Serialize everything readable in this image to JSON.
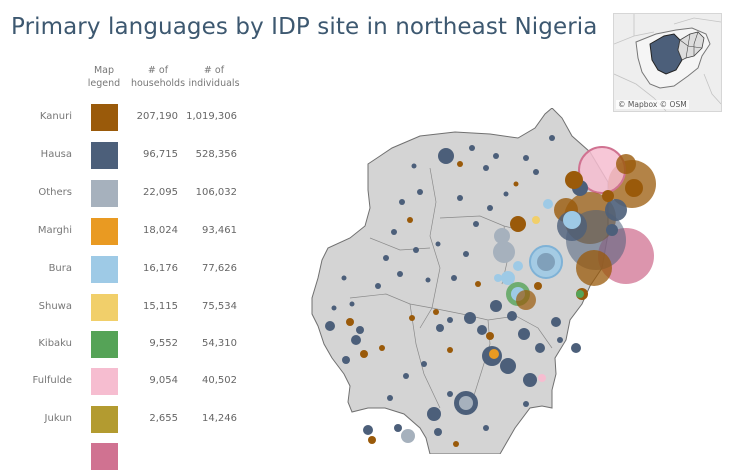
{
  "title": "Primary languages by IDP site in northeast Nigeria",
  "legend": {
    "header_legend": [
      "Map",
      "legend"
    ],
    "header_households": [
      "# of",
      "households"
    ],
    "header_individuals": [
      "# of",
      "individuals"
    ],
    "rows": [
      {
        "language": "Kanuri",
        "color": "#9a5a0a",
        "households": "207,190",
        "individuals": "1,019,306"
      },
      {
        "language": "Hausa",
        "color": "#4c5f7a",
        "households": "96,715",
        "individuals": "528,356"
      },
      {
        "language": "Others",
        "color": "#a6b1bd",
        "households": "22,095",
        "individuals": "106,032"
      },
      {
        "language": "Marghi",
        "color": "#e99a22",
        "households": "18,024",
        "individuals": "93,461"
      },
      {
        "language": "Bura",
        "color": "#9ecae6",
        "households": "16,176",
        "individuals": "77,626"
      },
      {
        "language": "Shuwa",
        "color": "#f1cf6a",
        "households": "15,115",
        "individuals": "75,534"
      },
      {
        "language": "Kibaku",
        "color": "#55a357",
        "households": "9,552",
        "individuals": "54,310"
      },
      {
        "language": "Fulfulde",
        "color": "#f6bdd0",
        "households": "9,054",
        "individuals": "40,502"
      },
      {
        "language": "Jukun",
        "color": "#b39b30",
        "households": "2,655",
        "individuals": "14,246"
      },
      {
        "language": "",
        "color": "#d07291",
        "households": "",
        "individuals": ""
      }
    ]
  },
  "inset": {
    "attribution": "© Mapbox  © OSM"
  }
}
